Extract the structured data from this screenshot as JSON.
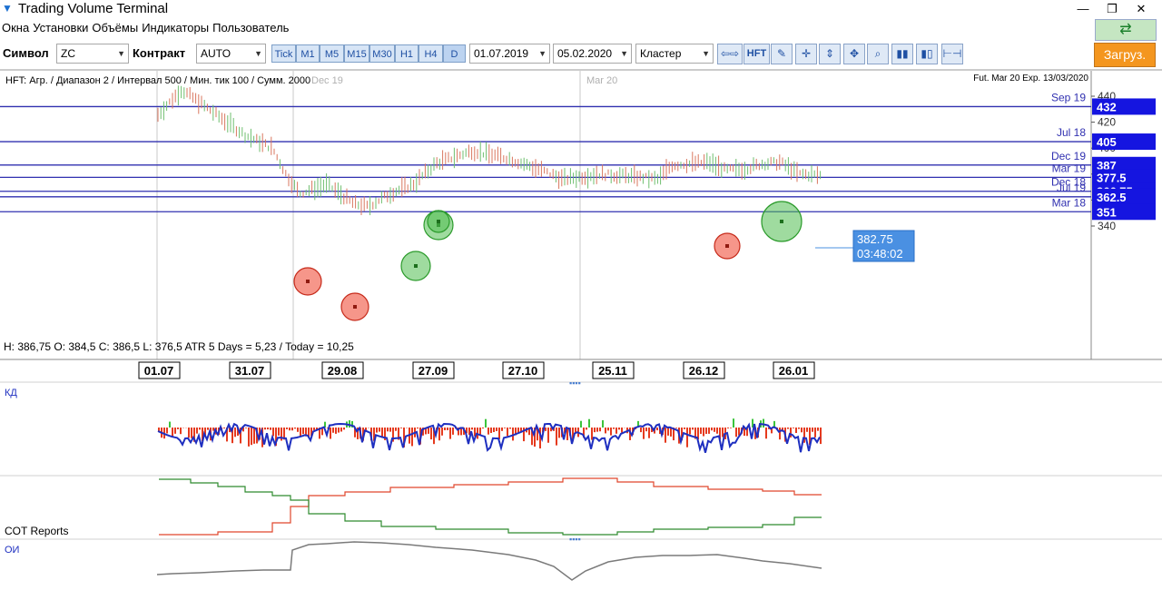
{
  "window": {
    "title": "Trading Volume Terminal"
  },
  "menu": [
    "Окна",
    "Установки",
    "Объёмы",
    "Индикаторы",
    "Пользователь"
  ],
  "toolbar": {
    "symbol_label": "Символ",
    "symbol_value": "ZC",
    "contract_label": "Контракт",
    "contract_value": "AUTO",
    "timeframes": [
      "Tick",
      "M1",
      "M5",
      "M15",
      "M30",
      "H1",
      "H4",
      "D"
    ],
    "date_from": "01.07.2019",
    "date_to": "05.02.2020",
    "chart_mode": "Кластер",
    "hft_label": "HFT",
    "load_label": "Загруз."
  },
  "chart": {
    "info_line": "HFT: Агр. / Диапазон 2 / Интервал 500 / Мин. тик 100 / Сумм. 2000",
    "contract_info": "Fut. Mar 20 Exp. 13/03/2020",
    "ohlc_line": "H: 386,75   O: 384,5   C: 386,5   L: 376,5   ATR 5 Days = 5,23 / Today = 10,25",
    "price_ticks": [
      "440",
      "420",
      "400",
      "380",
      "360",
      "340"
    ],
    "levels": [
      {
        "label": "Sep 19",
        "price": "432"
      },
      {
        "label": "Jul 18",
        "price": "405"
      },
      {
        "label": "Dec 19",
        "price": "387"
      },
      {
        "label": "Mar 19",
        "price": "377.5"
      },
      {
        "label": "Dec 18",
        "price": "366.75"
      },
      {
        "label": "Jul 19",
        "price": "362.5"
      },
      {
        "label": "Mar 18",
        "price": "351"
      }
    ],
    "vertical_labels": [
      "Dec 19",
      "Mar 20"
    ],
    "cursor": {
      "price": "382.75",
      "time": "03:48:02"
    },
    "date_labels": [
      "01.07",
      "31.07",
      "29.08",
      "27.09",
      "27.10",
      "25.11",
      "26.12",
      "26.01"
    ],
    "colors": {
      "up": "#33aa33",
      "down": "#e53a1e",
      "level": "#3030b0",
      "blue_line": "#1e2fc0"
    }
  },
  "panels": {
    "kd_label": "КД",
    "cot_label": "COT Reports",
    "oi_label": "ОИ"
  }
}
